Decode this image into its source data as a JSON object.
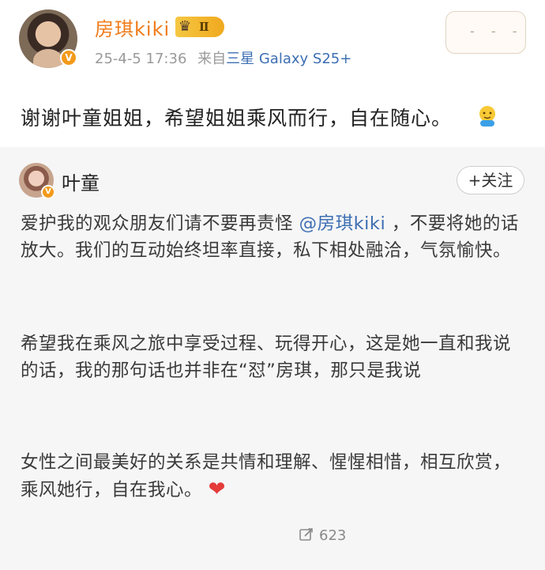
{
  "post": {
    "author_name": "房琪kiki",
    "level_badge": "Ⅱ",
    "timestamp": "25-4-5 17:36",
    "source_prefix": "来自",
    "source_device": "三星 Galaxy S25+",
    "stamp_text": "- - -",
    "text": "谢谢叶童姐姐，希望姐姐乘风而行，自在随心。",
    "emoji": "face-emoji"
  },
  "quoted": {
    "author_name": "叶童",
    "follow_label": "+关注",
    "paragraphs": {
      "p1_before": "爱护我的观众朋友们请不要再责怪 ",
      "p1_mention": "@房琪kiki",
      "p1_after": " ，不要将她的话放大。我们的互动始终坦率直接，私下相处融洽，气氛愉快。",
      "p2": "希望我在乘风之旅中享受过程、玩得开心，这是她一直和我说的话，我的那句话也并非在“怼”房琪，那只是我说",
      "p3": "女性之间最美好的关系是共情和理解、惺惺相惜，相互欣赏，乘风她行，自在我心。",
      "heart": "❤"
    },
    "share_count": "623"
  },
  "colors": {
    "author_orange": "#f07c1b",
    "link_blue": "#3d6fb3",
    "heart_red": "#e53b3b",
    "quote_bg": "#f6f6f6"
  }
}
